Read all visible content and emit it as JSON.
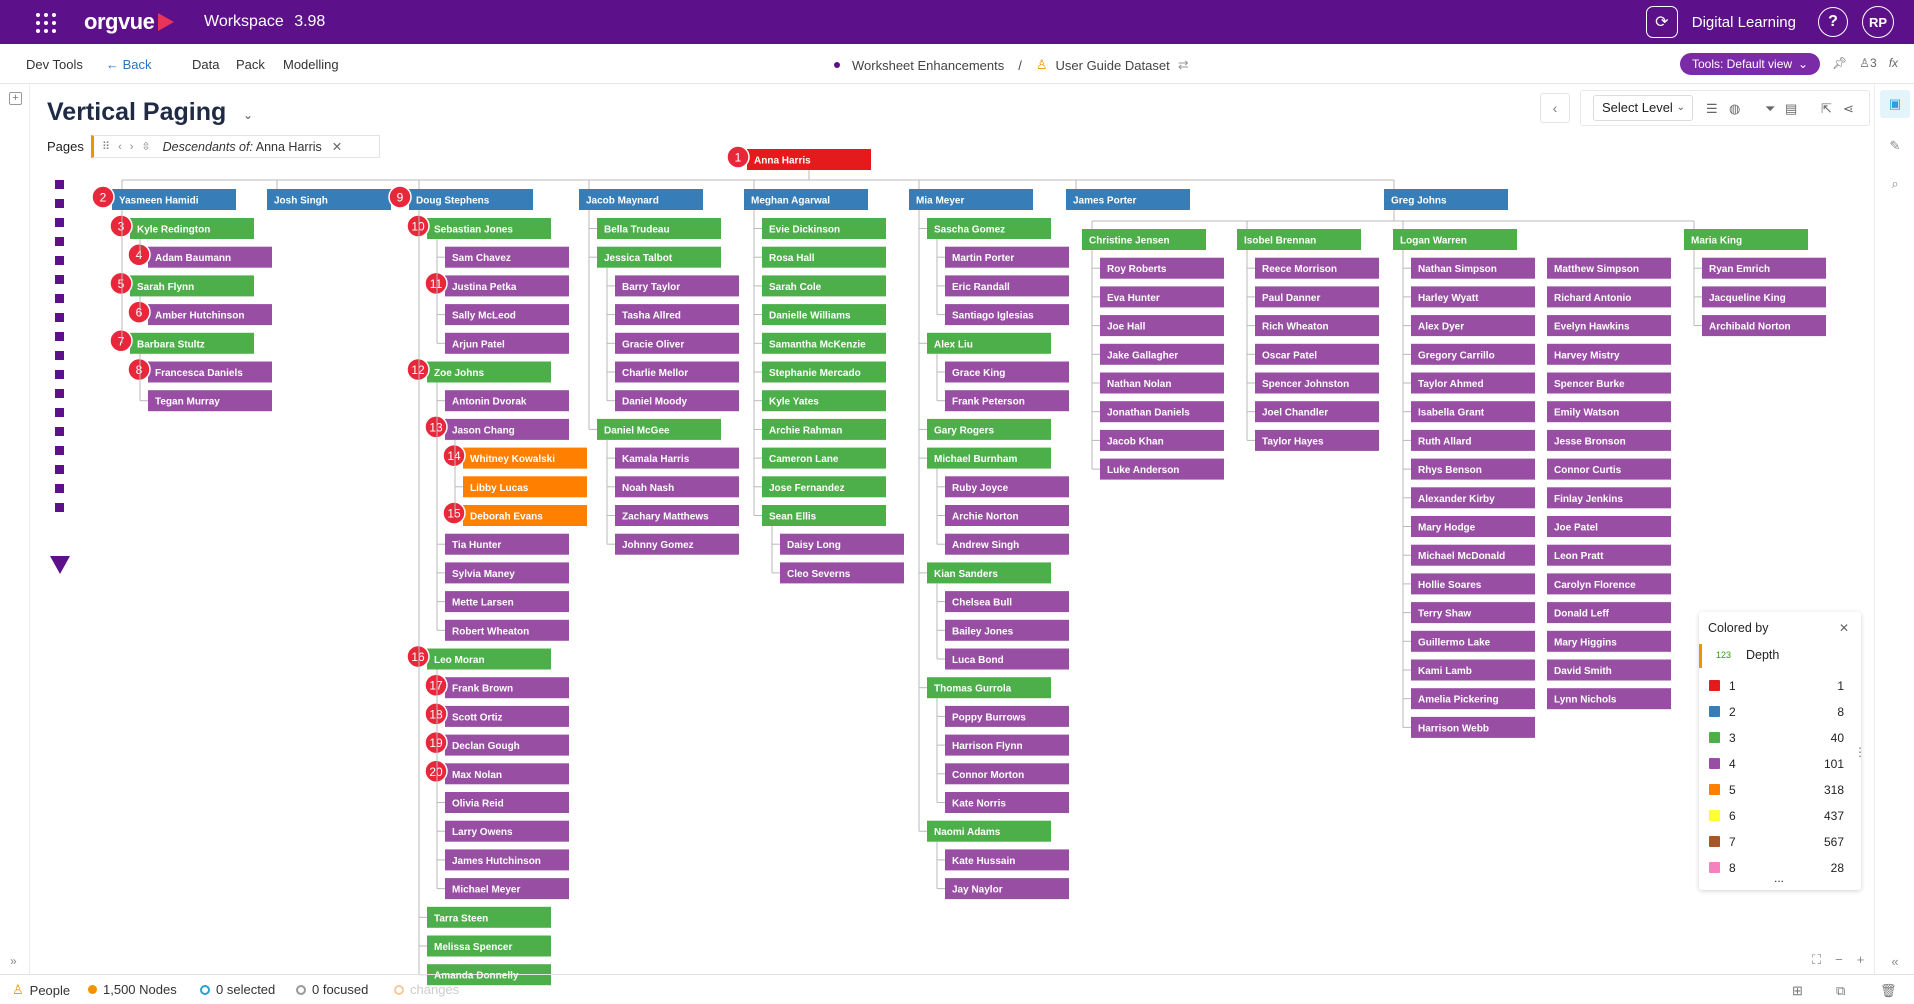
{
  "topbar": {
    "logo": "orgvue",
    "workspace_label": "Workspace",
    "workspace_version": "3.98",
    "digital_learning": "Digital Learning",
    "help": "?",
    "user_initials": "RP"
  },
  "menubar": {
    "dev_tools": "Dev Tools",
    "back": "Back",
    "data": "Data",
    "pack": "Pack",
    "modelling": "Modelling",
    "crumb_worksheet": "Worksheet Enhancements",
    "crumb_sep": "/",
    "crumb_dataset": "User Guide Dataset",
    "tools_button": "Tools: Default view",
    "users_count": "3",
    "fx": "fx"
  },
  "page": {
    "title": "Vertical Paging",
    "pages_label": "Pages",
    "filter_prefix": "Descendants of:",
    "filter_value": "Anna Harris",
    "select_level": "Select Level"
  },
  "colors": {
    "depth1": "#e41a1c",
    "depth2": "#377eb8",
    "depth3": "#4daf4a",
    "depth4": "#984ea3",
    "depth5": "#ff7f00",
    "depth6": "#ffff33",
    "depth7": "#a65628",
    "depth8": "#f781bf",
    "badge": "#e8273b",
    "brand": "#5c118a"
  },
  "legend": {
    "title": "Colored by",
    "field_type": "123",
    "field": "Depth",
    "rows": [
      {
        "level": "1",
        "count": "1",
        "color": "#e41a1c"
      },
      {
        "level": "2",
        "count": "8",
        "color": "#377eb8"
      },
      {
        "level": "3",
        "count": "40",
        "color": "#4daf4a"
      },
      {
        "level": "4",
        "count": "101",
        "color": "#984ea3"
      },
      {
        "level": "5",
        "count": "318",
        "color": "#ff7f00"
      },
      {
        "level": "6",
        "count": "437",
        "color": "#ffff33"
      },
      {
        "level": "7",
        "count": "567",
        "color": "#a65628"
      },
      {
        "level": "8",
        "count": "28",
        "color": "#f781bf"
      }
    ],
    "more": "..."
  },
  "status": {
    "dataset": "People",
    "nodes": "1,500 Nodes",
    "selected": "0 selected",
    "focused": "0 focused",
    "changes": "changes"
  },
  "root": {
    "name": "Anna Harris",
    "badge": "1"
  },
  "level2": [
    {
      "name": "Yasmeen Hamidi",
      "badge": "2"
    },
    {
      "name": "Josh Singh",
      "badge": ""
    },
    {
      "name": "Doug Stephens",
      "badge": "9"
    },
    {
      "name": "Jacob Maynard",
      "badge": ""
    },
    {
      "name": "Meghan Agarwal",
      "badge": ""
    },
    {
      "name": "Mia Meyer",
      "badge": ""
    },
    {
      "name": "James Porter",
      "badge": ""
    },
    {
      "name": "Greg Johns",
      "badge": ""
    }
  ],
  "columns": [
    {
      "parent": 0,
      "groups": [
        {
          "name": "Kyle Redington",
          "badge": "3",
          "children": [
            {
              "name": "Adam Baumann",
              "badge": "4"
            }
          ]
        },
        {
          "name": "Sarah Flynn",
          "badge": "5",
          "children": [
            {
              "name": "Amber Hutchinson",
              "badge": "6"
            }
          ]
        },
        {
          "name": "Barbara Stultz",
          "badge": "7",
          "children": [
            {
              "name": "Francesca Daniels",
              "badge": "8"
            },
            {
              "name": "Tegan Murray",
              "badge": ""
            }
          ]
        }
      ]
    },
    {
      "parent": 2,
      "groups": [
        {
          "name": "Sebastian Jones",
          "badge": "10",
          "children": [
            {
              "name": "Sam Chavez",
              "badge": ""
            },
            {
              "name": "Justina Petka",
              "badge": "11"
            },
            {
              "name": "Sally McLeod",
              "badge": ""
            },
            {
              "name": "Arjun Patel",
              "badge": ""
            }
          ]
        },
        {
          "name": "Zoe Johns",
          "badge": "12",
          "children": [
            {
              "name": "Antonin Dvorak",
              "badge": ""
            },
            {
              "name": "Jason Chang",
              "badge": "13",
              "children": [
                {
                  "name": "Whitney Kowalski",
                  "badge": "14"
                },
                {
                  "name": "Libby Lucas",
                  "badge": ""
                },
                {
                  "name": "Deborah Evans",
                  "badge": "15"
                }
              ]
            },
            {
              "name": "Tia Hunter",
              "badge": ""
            },
            {
              "name": "Sylvia Maney",
              "badge": ""
            },
            {
              "name": "Mette Larsen",
              "badge": ""
            },
            {
              "name": "Robert Wheaton",
              "badge": ""
            }
          ]
        },
        {
          "name": "Leo Moran",
          "badge": "16",
          "children": [
            {
              "name": "Frank Brown",
              "badge": "17"
            },
            {
              "name": "Scott Ortiz",
              "badge": "18"
            },
            {
              "name": "Declan Gough",
              "badge": "19"
            },
            {
              "name": "Max Nolan",
              "badge": "20"
            },
            {
              "name": "Olivia Reid",
              "badge": ""
            },
            {
              "name": "Larry Owens",
              "badge": ""
            },
            {
              "name": "James Hutchinson",
              "badge": ""
            },
            {
              "name": "Michael Meyer",
              "badge": ""
            }
          ]
        },
        {
          "name": "Tarra Steen",
          "badge": "",
          "children": []
        },
        {
          "name": "Melissa Spencer",
          "badge": "",
          "children": []
        },
        {
          "name": "Amanda Donnelly",
          "badge": "",
          "children": []
        }
      ]
    },
    {
      "parent": 3,
      "groups": [
        {
          "name": "Bella Trudeau",
          "badge": "",
          "children": []
        },
        {
          "name": "Jessica Talbot",
          "badge": "",
          "children": [
            {
              "name": "Barry Taylor",
              "badge": ""
            },
            {
              "name": "Tasha Allred",
              "badge": ""
            },
            {
              "name": "Gracie Oliver",
              "badge": ""
            },
            {
              "name": "Charlie Mellor",
              "badge": ""
            },
            {
              "name": "Daniel Moody",
              "badge": ""
            }
          ]
        },
        {
          "name": "Daniel McGee",
          "badge": "",
          "children": [
            {
              "name": "Kamala Harris",
              "badge": ""
            },
            {
              "name": "Noah Nash",
              "badge": ""
            },
            {
              "name": "Zachary Matthews",
              "badge": ""
            },
            {
              "name": "Johnny Gomez",
              "badge": ""
            }
          ]
        }
      ]
    },
    {
      "parent": 4,
      "groups": [
        {
          "name": "Evie Dickinson",
          "badge": "",
          "children": []
        },
        {
          "name": "Rosa Hall",
          "badge": "",
          "children": []
        },
        {
          "name": "Sarah Cole",
          "badge": "",
          "children": []
        },
        {
          "name": "Danielle Williams",
          "badge": "",
          "children": []
        },
        {
          "name": "Samantha McKenzie",
          "badge": "",
          "children": []
        },
        {
          "name": "Stephanie Mercado",
          "badge": "",
          "children": []
        },
        {
          "name": "Kyle Yates",
          "badge": "",
          "children": []
        },
        {
          "name": "Archie Rahman",
          "badge": "",
          "children": []
        },
        {
          "name": "Cameron Lane",
          "badge": "",
          "children": []
        },
        {
          "name": "Jose Fernandez",
          "badge": "",
          "children": []
        },
        {
          "name": "Sean Ellis",
          "badge": "",
          "children": [
            {
              "name": "Daisy Long",
              "badge": ""
            },
            {
              "name": "Cleo Severns",
              "badge": ""
            }
          ]
        }
      ]
    },
    {
      "parent": 5,
      "groups": [
        {
          "name": "Sascha Gomez",
          "badge": "",
          "children": [
            {
              "name": "Martin Porter",
              "badge": ""
            },
            {
              "name": "Eric Randall",
              "badge": ""
            },
            {
              "name": "Santiago Iglesias",
              "badge": ""
            }
          ]
        },
        {
          "name": "Alex Liu",
          "badge": "",
          "children": [
            {
              "name": "Grace King",
              "badge": ""
            },
            {
              "name": "Frank Peterson",
              "badge": ""
            }
          ]
        },
        {
          "name": "Gary Rogers",
          "badge": "",
          "children": []
        },
        {
          "name": "Michael Burnham",
          "badge": "",
          "children": [
            {
              "name": "Ruby Joyce",
              "badge": ""
            },
            {
              "name": "Archie Norton",
              "badge": ""
            },
            {
              "name": "Andrew Singh",
              "badge": ""
            }
          ]
        },
        {
          "name": "Kian Sanders",
          "badge": "",
          "children": [
            {
              "name": "Chelsea Bull",
              "badge": ""
            },
            {
              "name": "Bailey Jones",
              "badge": ""
            },
            {
              "name": "Luca Bond",
              "badge": ""
            }
          ]
        },
        {
          "name": "Thomas Gurrola",
          "badge": "",
          "children": [
            {
              "name": "Poppy Burrows",
              "badge": ""
            },
            {
              "name": "Harrison Flynn",
              "badge": ""
            },
            {
              "name": "Connor Morton",
              "badge": ""
            },
            {
              "name": "Kate Norris",
              "badge": ""
            }
          ]
        },
        {
          "name": "Naomi Adams",
          "badge": "",
          "children": [
            {
              "name": "Kate Hussain",
              "badge": ""
            },
            {
              "name": "Jay Naylor",
              "badge": ""
            }
          ]
        }
      ]
    }
  ],
  "greg_children": [
    {
      "name": "Christine Jensen",
      "children": [
        "Roy Roberts",
        "Eva Hunter",
        "Joe Hall",
        "Jake Gallagher",
        "Nathan Nolan",
        "Jonathan Daniels",
        "Jacob Khan",
        "Luke Anderson"
      ]
    },
    {
      "name": "Isobel Brennan",
      "children": [
        "Reece Morrison",
        "Paul Danner",
        "Rich Wheaton",
        "Oscar Patel",
        "Spencer Johnston",
        "Joel Chandler",
        "Taylor Hayes"
      ]
    },
    {
      "name": "Logan Warren",
      "children": [
        "Nathan Simpson",
        "Harley Wyatt",
        "Alex Dyer",
        "Gregory Carrillo",
        "Taylor Ahmed",
        "Isabella Grant",
        "Ruth Allard",
        "Rhys Benson",
        "Alexander Kirby",
        "Mary Hodge",
        "Michael McDonald",
        "Hollie Soares",
        "Terry Shaw",
        "Guillermo Lake",
        "Kami Lamb",
        "Amelia Pickering",
        "Harrison Webb"
      ],
      "children2": [
        "Matthew Simpson",
        "Richard Antonio",
        "Evelyn Hawkins",
        "Harvey Mistry",
        "Spencer Burke",
        "Emily Watson",
        "Jesse Bronson",
        "Connor Curtis",
        "Finlay Jenkins",
        "Joe Patel",
        "Leon Pratt",
        "Carolyn Florence",
        "Donald Leff",
        "Mary Higgins",
        "David Smith",
        "Lynn Nichols"
      ]
    },
    {
      "name": "Maria King",
      "children": [
        "Ryan Emrich",
        "Jacqueline King",
        "Archibald Norton"
      ]
    }
  ]
}
